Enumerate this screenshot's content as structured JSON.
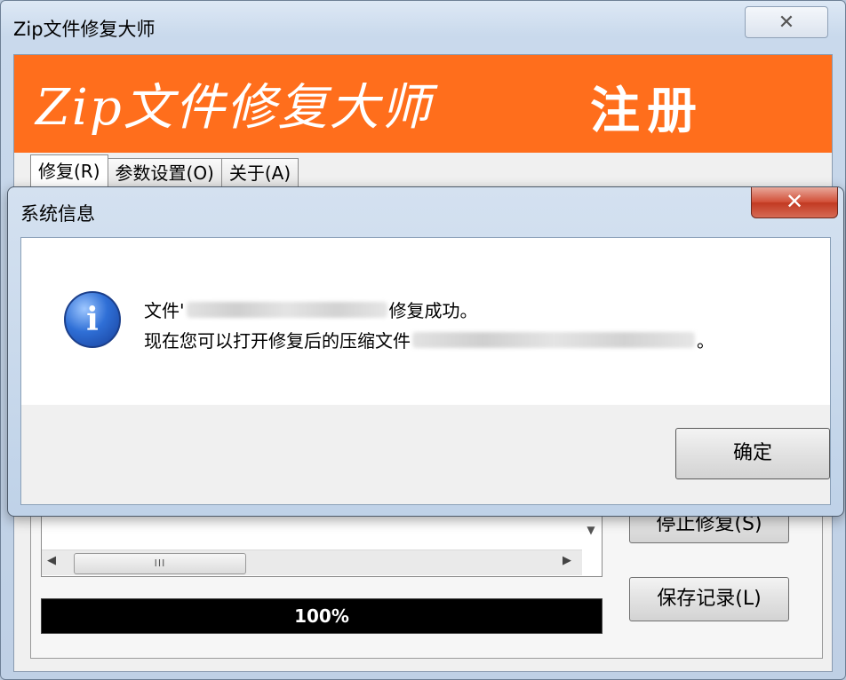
{
  "main_window": {
    "title": "Zip文件修复大师",
    "close_glyph": "✕",
    "banner": {
      "title": "Zip文件修复大师",
      "register": "注册",
      "background": "#ff6e1c"
    },
    "tabs": [
      {
        "label": "修复(R)"
      },
      {
        "label": "参数设置(O)"
      },
      {
        "label": "关于(A)"
      }
    ],
    "scrollbar_grip": "III",
    "progress": {
      "value": 1.0,
      "label": "100%"
    },
    "buttons": {
      "stop_repair": "停止修复(S)",
      "save_log": "保存记录(L)"
    }
  },
  "dialog": {
    "title": "系统信息",
    "close_glyph": "✕",
    "icon": "info-icon",
    "message": {
      "line1_prefix": "文件'",
      "line1_suffix": "修复成功。",
      "line2_prefix": "现在您可以打开修复后的压缩文件",
      "line2_suffix": "。"
    },
    "ok_button": "确定"
  },
  "colors": {
    "banner_orange": "#ff6e1c",
    "close_red": "#c23a22",
    "info_blue": "#2f6fd6"
  }
}
